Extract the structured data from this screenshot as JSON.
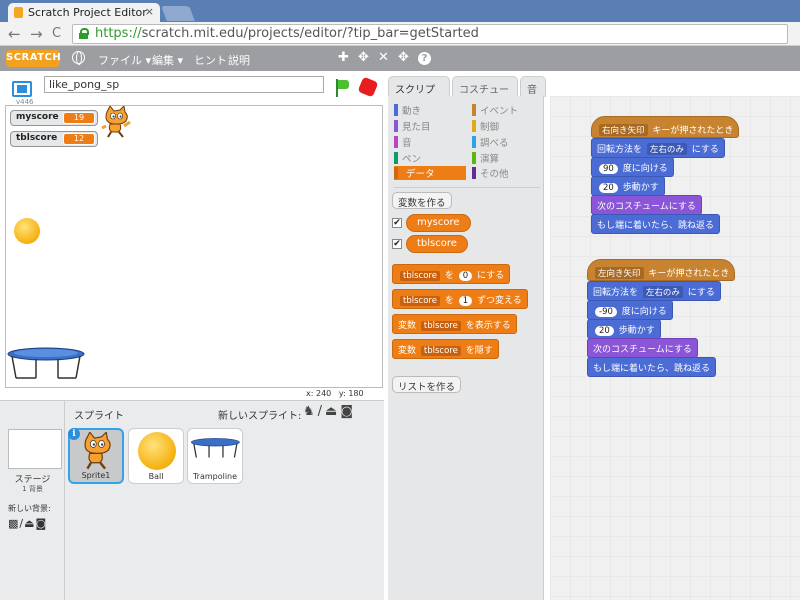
{
  "browser": {
    "tab_title": "Scratch Project Editor",
    "tab_close": "×",
    "url_https": "https://",
    "url_rest": "scratch.mit.edu/projects/editor/?tip_bar=getStarted",
    "back": "←",
    "forward": "→",
    "reload": "C"
  },
  "menubar": {
    "logo": "SCRATCH",
    "file": "ファイル ▾",
    "edit": "編集 ▾",
    "tips": "ヒント",
    "about": "説明",
    "tools": [
      "✚",
      "✥",
      "✕",
      "✥",
      "?"
    ]
  },
  "stage": {
    "version": "v446",
    "project_title": "like_pong_sp",
    "monitors": [
      {
        "name": "myscore",
        "value": "19"
      },
      {
        "name": "tblscore",
        "value": "12"
      }
    ],
    "coords_x_label": "x:",
    "coords_x": "240",
    "coords_y_label": "y:",
    "coords_y": "180"
  },
  "sprites": {
    "header": "スプライト",
    "new_sprite": "新しいスプライト:",
    "new_sprite_tools": "♞/⏏◙",
    "stage_label": "ステージ",
    "backdrop_count": "1 背景",
    "new_backdrop": "新しい背景:",
    "backdrop_tools": "▩/⏏◙",
    "items": [
      {
        "name": "Sprite1",
        "selected": true
      },
      {
        "name": "Ball"
      },
      {
        "name": "Trampoline"
      }
    ],
    "info": "i"
  },
  "tabs": {
    "scripts": "スクリプト",
    "costumes": "コスチューム",
    "sounds": "音"
  },
  "categories": {
    "motion": "動き",
    "looks": "見た目",
    "sound": "音",
    "pen": "ペン",
    "data": "データ",
    "events": "イベント",
    "control": "制御",
    "sensing": "調べる",
    "operators": "演算",
    "more": "その他"
  },
  "colors": {
    "motion": "#4a6cd4",
    "looks": "#8a55d7",
    "sound": "#bb42c3",
    "pen": "#0e9a6c",
    "data": "#ee7d16",
    "events": "#c88330",
    "control": "#e1a91a",
    "sensing": "#2ca5e2",
    "operators": "#5cb712",
    "more": "#632d99"
  },
  "palette": {
    "make_variable": "変数を作る",
    "make_list": "リストを作る",
    "vars": [
      "myscore",
      "tblscore"
    ],
    "check": "✔",
    "set": {
      "var": "tblscore",
      "mid": "を",
      "value": "0",
      "end": "にする"
    },
    "change": {
      "var": "tblscore",
      "mid": "を",
      "value": "1",
      "end": "ずつ変える"
    },
    "show": {
      "prefix": "変数",
      "var": "tblscore",
      "end": "を表示する"
    },
    "hide": {
      "prefix": "変数",
      "var": "tblscore",
      "end": "を隠す"
    }
  },
  "scripts": [
    {
      "hat_key": "右向き矢印",
      "hat_text": "キーが押されたとき",
      "rotation_prefix": "回転方法を",
      "rotation_value": "左右のみ",
      "rotation_end": "にする",
      "direction": "90",
      "direction_end": "度に向ける",
      "steps": "20",
      "steps_end": "歩動かす",
      "next_costume": "次のコスチュームにする",
      "bounce": "もし端に着いたら、跳ね返る"
    },
    {
      "hat_key": "左向き矢印",
      "hat_text": "キーが押されたとき",
      "rotation_prefix": "回転方法を",
      "rotation_value": "左右のみ",
      "rotation_end": "にする",
      "direction": "-90",
      "direction_end": "度に向ける",
      "steps": "20",
      "steps_end": "歩動かす",
      "next_costume": "次のコスチュームにする",
      "bounce": "もし端に着いたら、跳ね返る"
    }
  ]
}
